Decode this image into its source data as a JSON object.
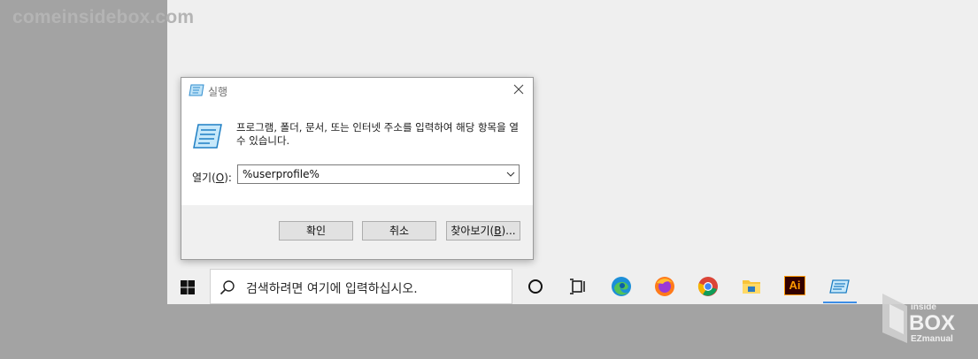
{
  "watermark": "comeinsidebox.com",
  "dialog": {
    "title": "실행",
    "description": "프로그램, 폴더, 문서, 또는 인터넷 주소를 입력하여 해당 항목을 열 수 있습니다.",
    "open_label_prefix": "열기(",
    "open_label_key": "O",
    "open_label_suffix": "):",
    "input_value": "%userprofile%",
    "ok_label": "확인",
    "cancel_label": "취소",
    "browse_label_prefix": "찾아보기(",
    "browse_label_key": "B",
    "browse_label_suffix": ")..."
  },
  "taskbar": {
    "search_placeholder": "검색하려면 여기에 입력하십시오.",
    "icons": [
      "windows-start-icon",
      "search-icon",
      "cortana-icon",
      "task-view-icon",
      "edge-icon",
      "firefox-icon",
      "chrome-icon",
      "file-explorer-icon",
      "illustrator-icon",
      "run-app-icon"
    ],
    "illustrator_label": "Ai"
  },
  "logo": {
    "line1": "inside",
    "line2": "BOX",
    "line3": "EZmanual"
  },
  "colors": {
    "accent": "#3d8ee6",
    "desktop": "#efefef",
    "outside": "#a3a3a3"
  }
}
